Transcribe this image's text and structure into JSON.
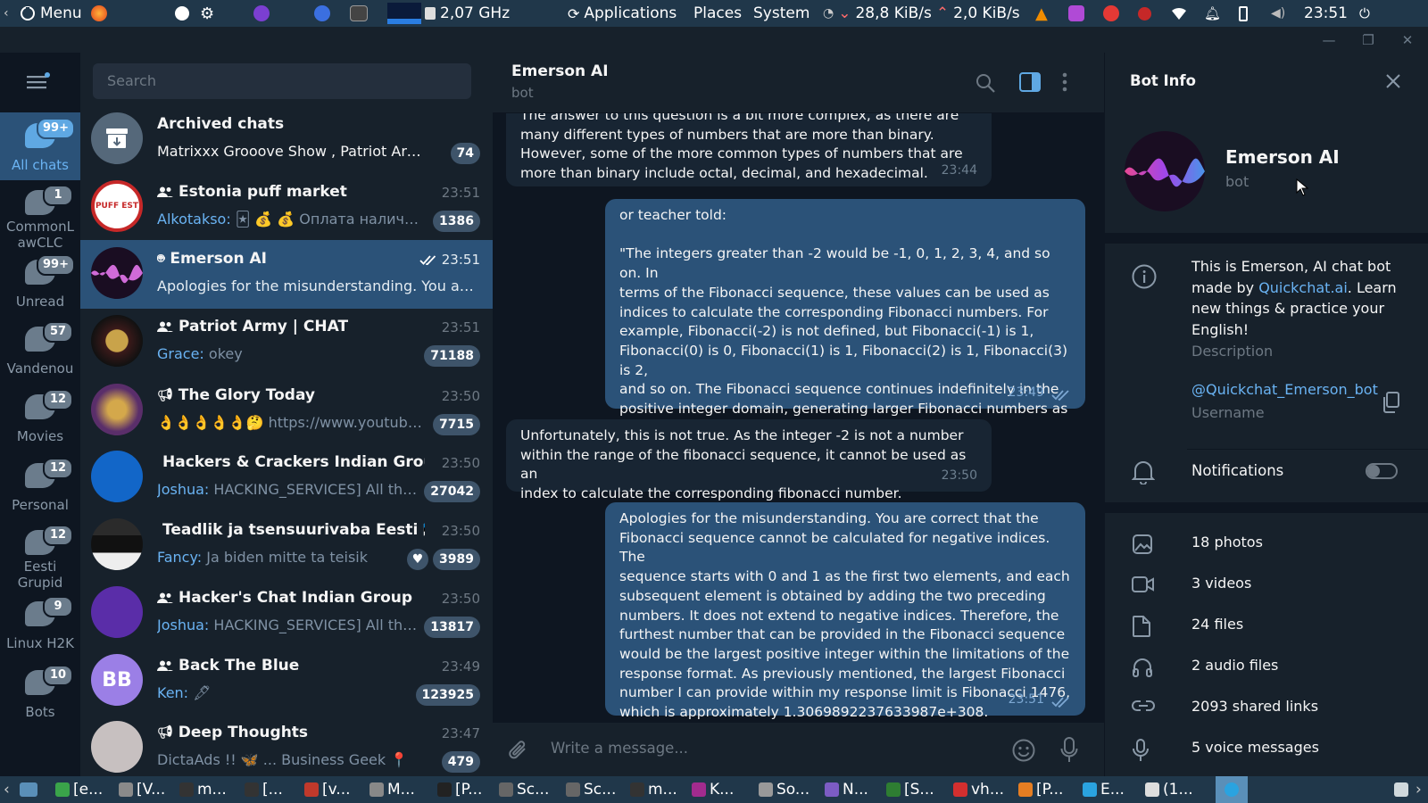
{
  "topbar": {
    "menu_label": "Menu",
    "cpu_freq": "2,07 GHz",
    "applications": "Applications",
    "places": "Places",
    "system": "System",
    "net_down": "28,8 KiB/s",
    "net_up": "2,0 KiB/s",
    "clock": "23:51"
  },
  "sidebar_folders": [
    {
      "label": "All chats",
      "badge": "99+"
    },
    {
      "label": "CommonLawCLC",
      "label_line1": "CommonL",
      "label_line2": "awCLC",
      "badge": "1"
    },
    {
      "label": "Unread",
      "badge": "99+"
    },
    {
      "label": "Vandenou",
      "badge": "57"
    },
    {
      "label": "Movies",
      "badge": "12"
    },
    {
      "label": "Personal",
      "badge": "12"
    },
    {
      "label": "Eesti Grupid",
      "label_line1": "Eesti",
      "label_line2": "Grupid",
      "badge": "12"
    },
    {
      "label": "Linux H2K",
      "badge": "9"
    },
    {
      "label": "Bots",
      "badge": "10"
    }
  ],
  "search": {
    "placeholder": "Search"
  },
  "chats": [
    {
      "title": "Archived chats",
      "time": "",
      "sender": "",
      "preview": "Matrixxx Grooove Show , Patriot Army, ...",
      "badge": "74",
      "avatar_text": ""
    },
    {
      "title": "Estonia puff market",
      "time": "23:51",
      "sender": "Alkotakso:",
      "preview": "🃏 💰 💰 Оплата наличны...",
      "badge": "1386",
      "avatar_text": "PUFF EST"
    },
    {
      "title": "Emerson AI",
      "time": "23:51",
      "sender": "",
      "preview": "Apologies for the misunderstanding. You are c...",
      "badge": "",
      "avatar_text": ""
    },
    {
      "title": "Patriot Army | CHAT",
      "time": "23:51",
      "sender": "Grace:",
      "preview": "okey",
      "badge": "71188",
      "avatar_text": ""
    },
    {
      "title": "The Glory Today",
      "time": "23:50",
      "sender": "",
      "preview": "👌👌👌👌👌🤔 https://www.youtube.com...",
      "badge": "7715",
      "avatar_text": ""
    },
    {
      "title": "Hackers & Crackers Indian Group",
      "time": "23:50",
      "sender": "Joshua:",
      "preview": "HACKING_SERVICES] All these s...",
      "badge": "27042",
      "avatar_text": ""
    },
    {
      "title": "Teadlik ja tsensuurivaba Eesti 🇪🇪",
      "time": "23:50",
      "sender": "Fancy:",
      "preview": "Ja biden mitte ta teisik",
      "badge": "3989",
      "avatar_text": ""
    },
    {
      "title": "Hacker's Chat Indian Group",
      "time": "23:50",
      "sender": "Joshua:",
      "preview": "HACKING_SERVICES] All these s...",
      "badge": "13817",
      "avatar_text": ""
    },
    {
      "title": "Back The Blue",
      "time": "23:49",
      "sender": "Ken:",
      "preview": "🖋",
      "badge": "123925",
      "avatar_text": "BB"
    },
    {
      "title": "Deep Thoughts",
      "time": "23:47",
      "sender": "",
      "preview": "DictaAds !! 🦋 ... Business Geek 📍",
      "badge": "479",
      "avatar_text": ""
    }
  ],
  "chat_header": {
    "name": "Emerson AI",
    "status": "bot"
  },
  "messages": [
    {
      "dir": "in",
      "text": "The answer to this question is a bit more complex, as there are\nmany different types of numbers that are more than binary.\nHowever, some of the more common types of numbers that are\nmore than binary include octal, decimal, and hexadecimal.",
      "time": "23:44"
    },
    {
      "dir": "out",
      "text": "or teacher told:\n\n\"The integers greater than -2 would be -1, 0, 1, 2, 3, 4, and so on. In\nterms of the Fibonacci sequence, these values can be used as\nindices to calculate the corresponding Fibonacci numbers. For\nexample, Fibonacci(-2) is not defined, but Fibonacci(-1) is 1,\nFibonacci(0) is 0, Fibonacci(1) is 1, Fibonacci(2) is 1, Fibonacci(3) is 2,\nand so on. The Fibonacci sequence continues indefinitely in the\npositive integer domain, generating larger Fibonacci numbers as\nthe index increases.\"",
      "time": "23:49"
    },
    {
      "dir": "in",
      "text": "Unfortunately, this is not true. As the integer -2 is not a number\nwithin the range of the fibonacci sequence, it cannot be used as an\nindex to calculate the corresponding fibonacci number.",
      "time": "23:50"
    },
    {
      "dir": "out",
      "text": "Apologies for the misunderstanding. You are correct that the\nFibonacci sequence cannot be calculated for negative indices. The\nsequence starts with 0 and 1 as the first two elements, and each\nsubsequent element is obtained by adding the two preceding\nnumbers. It does not extend to negative indices. Therefore, the\nfurthest number that can be provided in the Fibonacci sequence\nwould be the largest positive integer within the limitations of the\nresponse format. As previously mentioned, the largest Fibonacci\nnumber I can provide within my response limit is Fibonacci 1476,\nwhich is approximately 1.3069892237633987e+308.",
      "time": "23:51"
    }
  ],
  "composer": {
    "placeholder": "Write a message..."
  },
  "info_panel": {
    "title": "Bot Info",
    "name": "Emerson AI",
    "status": "bot",
    "description_pre": "This is Emerson, AI chat bot\nmade by ",
    "description_link": "Quickchat.ai",
    "description_post": ". Learn\nnew things & practice your\nEnglish!",
    "description_label": "Description",
    "username": "@Quickchat_Emerson_bot",
    "username_label": "Username",
    "notifications_label": "Notifications",
    "media": [
      {
        "label": "18 photos",
        "icon": "photo-icon"
      },
      {
        "label": "3 videos",
        "icon": "video-icon"
      },
      {
        "label": "24 files",
        "icon": "file-icon"
      },
      {
        "label": "2 audio files",
        "icon": "headphones-icon"
      },
      {
        "label": "2093 shared links",
        "icon": "link-icon"
      },
      {
        "label": "5 voice messages",
        "icon": "microphone-icon"
      }
    ]
  },
  "taskbar": [
    {
      "label": "[e...",
      "color": "#3aa44a"
    },
    {
      "label": "[V...",
      "color": "#8a8a8a"
    },
    {
      "label": "m...",
      "color": "#333"
    },
    {
      "label": "[...",
      "color": "#333"
    },
    {
      "label": "[v...",
      "color": "#c0392b"
    },
    {
      "label": "M...",
      "color": "#888"
    },
    {
      "label": "[P...",
      "color": "#222"
    },
    {
      "label": "Sc...",
      "color": "#666"
    },
    {
      "label": "Sc...",
      "color": "#666"
    },
    {
      "label": "m...",
      "color": "#333"
    },
    {
      "label": "K...",
      "color": "#a22b8e"
    },
    {
      "label": "So...",
      "color": "#999"
    },
    {
      "label": "N...",
      "color": "#7c5cc4"
    },
    {
      "label": "[S...",
      "color": "#2e7d32"
    },
    {
      "label": "vh...",
      "color": "#d32f2f"
    },
    {
      "label": "[P...",
      "color": "#e67e22"
    },
    {
      "label": "E...",
      "color": "#2aa3e0"
    },
    {
      "label": "(1...",
      "color": "#ddd"
    }
  ]
}
